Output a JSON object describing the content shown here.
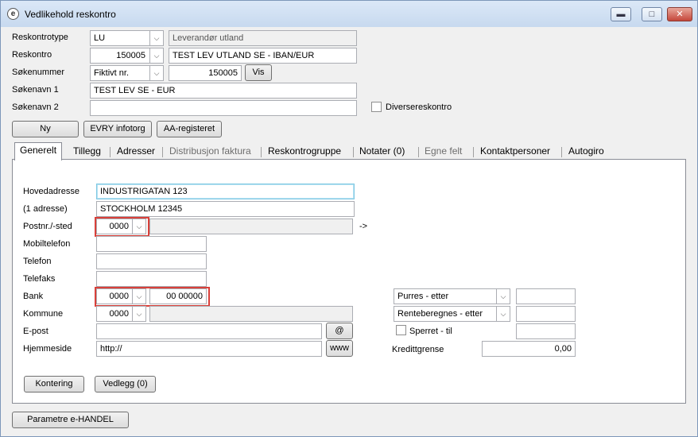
{
  "window": {
    "title": "Vedlikehold reskontro",
    "controls": {
      "minimize": "▬",
      "maximize": "□",
      "close": "✕"
    }
  },
  "header": {
    "reskontrotype": {
      "label": "Reskontrotype",
      "code": "LU",
      "description": "Leverandør utland"
    },
    "reskontro": {
      "label": "Reskontro",
      "number": "150005",
      "name": "TEST LEV UTLAND SE - IBAN/EUR"
    },
    "sokenummer": {
      "label": "Søkenummer",
      "type": "Fiktivt nr.",
      "value": "150005",
      "vis_button": "Vis"
    },
    "sokenavn1": {
      "label": "Søkenavn 1",
      "value": "TEST LEV SE - EUR"
    },
    "sokenavn2": {
      "label": "Søkenavn 2",
      "value": ""
    },
    "diversereskontro_label": "Diversereskontro",
    "buttons": {
      "ny": "Ny",
      "evry": "EVRY infotorg",
      "aa": "AA-registeret"
    }
  },
  "tabs": [
    {
      "label": "Generelt",
      "active": true,
      "enabled": true
    },
    {
      "label": "Tillegg",
      "active": false,
      "enabled": true
    },
    {
      "label": "Adresser",
      "active": false,
      "enabled": true
    },
    {
      "label": "Distribusjon faktura",
      "active": false,
      "enabled": false
    },
    {
      "label": "Reskontrogruppe",
      "active": false,
      "enabled": true
    },
    {
      "label": "Notater (0)",
      "active": false,
      "enabled": true
    },
    {
      "label": "Egne felt",
      "active": false,
      "enabled": false
    },
    {
      "label": "Kontaktpersoner",
      "active": false,
      "enabled": true
    },
    {
      "label": "Autogiro",
      "active": false,
      "enabled": true
    }
  ],
  "general": {
    "hovedadresse": {
      "label": "Hovedadresse",
      "value": "INDUSTRIGATAN 123"
    },
    "adresse1": {
      "label": "(1 adresse)",
      "value": "STOCKHOLM 12345"
    },
    "postnr": {
      "label": "Postnr./-sted",
      "code": "0000",
      "place": "",
      "arrow": "->"
    },
    "mobiltelefon": {
      "label": "Mobiltelefon",
      "value": ""
    },
    "telefon": {
      "label": "Telefon",
      "value": ""
    },
    "telefaks": {
      "label": "Telefaks",
      "value": ""
    },
    "bank": {
      "label": "Bank",
      "code": "0000",
      "account": "00 00000"
    },
    "kommune": {
      "label": "Kommune",
      "code": "0000",
      "name": ""
    },
    "epost": {
      "label": "E-post",
      "value": "",
      "button": "@"
    },
    "hjemmeside": {
      "label": "Hjemmeside",
      "value": "http://",
      "button": "www"
    },
    "purres": {
      "option": "Purres - etter",
      "value": ""
    },
    "renteberegnes": {
      "option": "Renteberegnes - etter",
      "value": ""
    },
    "sperret": {
      "label": "Sperret  -  til",
      "value": ""
    },
    "kredittgrense": {
      "label": "Kredittgrense",
      "value": "0,00"
    },
    "buttons": {
      "kontering": "Kontering",
      "vedlegg": "Vedlegg (0)"
    }
  },
  "footer": {
    "parametre_button": "Parametre e-HANDEL"
  }
}
